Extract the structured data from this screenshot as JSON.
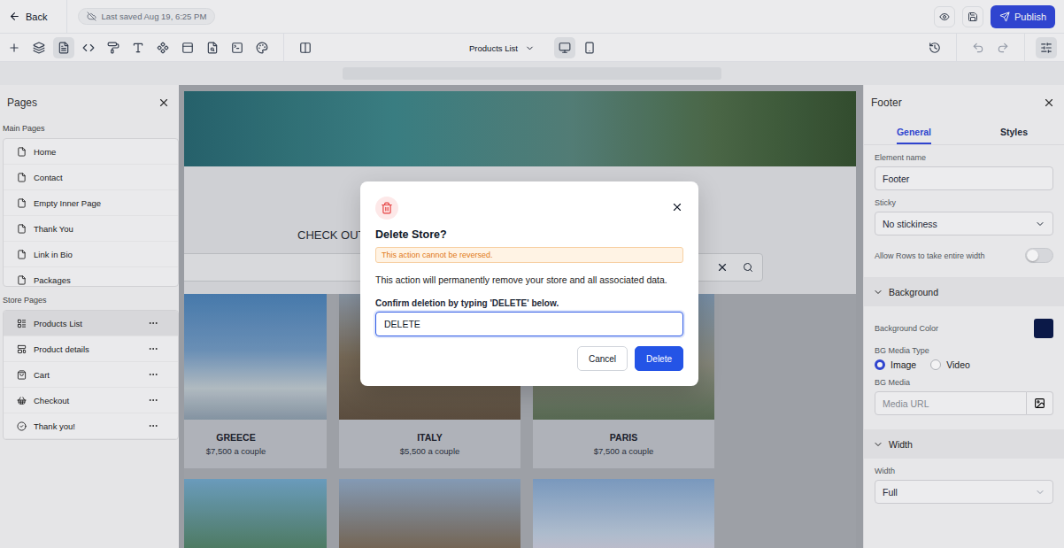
{
  "topbar": {
    "back": "Back",
    "last_saved": "Last saved Aug 19, 6:25 PM",
    "publish": "Publish"
  },
  "toolbar": {
    "tools": [
      {
        "selected": false
      },
      {
        "selected": false
      },
      {
        "selected": true
      },
      {
        "selected": false
      },
      {
        "selected": false
      },
      {
        "selected": false
      },
      {
        "selected": false
      },
      {
        "selected": false
      },
      {
        "selected": false
      },
      {
        "selected": false
      },
      {
        "selected": false
      }
    ],
    "page_select": "Products List",
    "devices": [
      {
        "selected": true
      },
      {
        "selected": false
      }
    ]
  },
  "pages_panel": {
    "title": "Pages",
    "sections": [
      {
        "title": "Main Pages",
        "items": [
          {
            "label": "Home",
            "selected": false
          },
          {
            "label": "Contact",
            "selected": false
          },
          {
            "label": "Empty Inner Page",
            "selected": false
          },
          {
            "label": "Thank You",
            "selected": false
          },
          {
            "label": "Link in Bio",
            "selected": false
          },
          {
            "label": "Packages",
            "selected": false
          }
        ]
      },
      {
        "title": "Store Pages",
        "items": [
          {
            "label": "Products List",
            "selected": true
          },
          {
            "label": "Product details",
            "selected": false
          },
          {
            "label": "Cart",
            "selected": false
          },
          {
            "label": "Checkout",
            "selected": false
          },
          {
            "label": "Thank you!",
            "selected": false
          }
        ]
      }
    ]
  },
  "canvas": {
    "heading": "CHECK OUT",
    "products": [
      {
        "kind": "card",
        "name": "GREECE",
        "price": "$7,500 a couple"
      },
      {
        "kind": "card",
        "name": "ITALY",
        "price": "$5,500 a couple"
      },
      {
        "kind": "card",
        "name": "PARIS",
        "price": "$7,500 a couple"
      },
      {
        "kind": "photo"
      },
      {
        "kind": "photo"
      },
      {
        "kind": "photo"
      }
    ]
  },
  "properties_panel": {
    "title": "Footer",
    "tabs": [
      {
        "label": "General",
        "selected": true
      },
      {
        "label": "Styles",
        "selected": false
      }
    ],
    "element_name": {
      "label": "Element name",
      "value": "Footer"
    },
    "sticky": {
      "label": "Sticky",
      "value": "No stickiness"
    },
    "full_width": {
      "label": "Allow Rows to take entire width",
      "on": false
    },
    "background": {
      "title": "Background",
      "expanded": true,
      "color_label": "Background Color",
      "color_value": "#0b1a4a",
      "media_type": {
        "label": "BG Media Type",
        "options": [
          {
            "label": "Image",
            "selected": true
          },
          {
            "label": "Video",
            "selected": false
          }
        ]
      },
      "media": {
        "label": "BG Media",
        "placeholder": "Media URL"
      }
    },
    "width": {
      "title": "Width",
      "expanded": true,
      "label": "Width",
      "value": "Full"
    }
  },
  "dialog": {
    "title": "Delete Store?",
    "warning": "This action cannot be reversed.",
    "message": "This action will permanently remove your store and all associated data.",
    "confirm_label": "Confirm deletion by typing 'DELETE' below.",
    "input_value": "DELETE",
    "buttons": [
      {
        "label": "Cancel",
        "kind": "secondary"
      },
      {
        "label": "Delete",
        "kind": "primary"
      }
    ]
  }
}
